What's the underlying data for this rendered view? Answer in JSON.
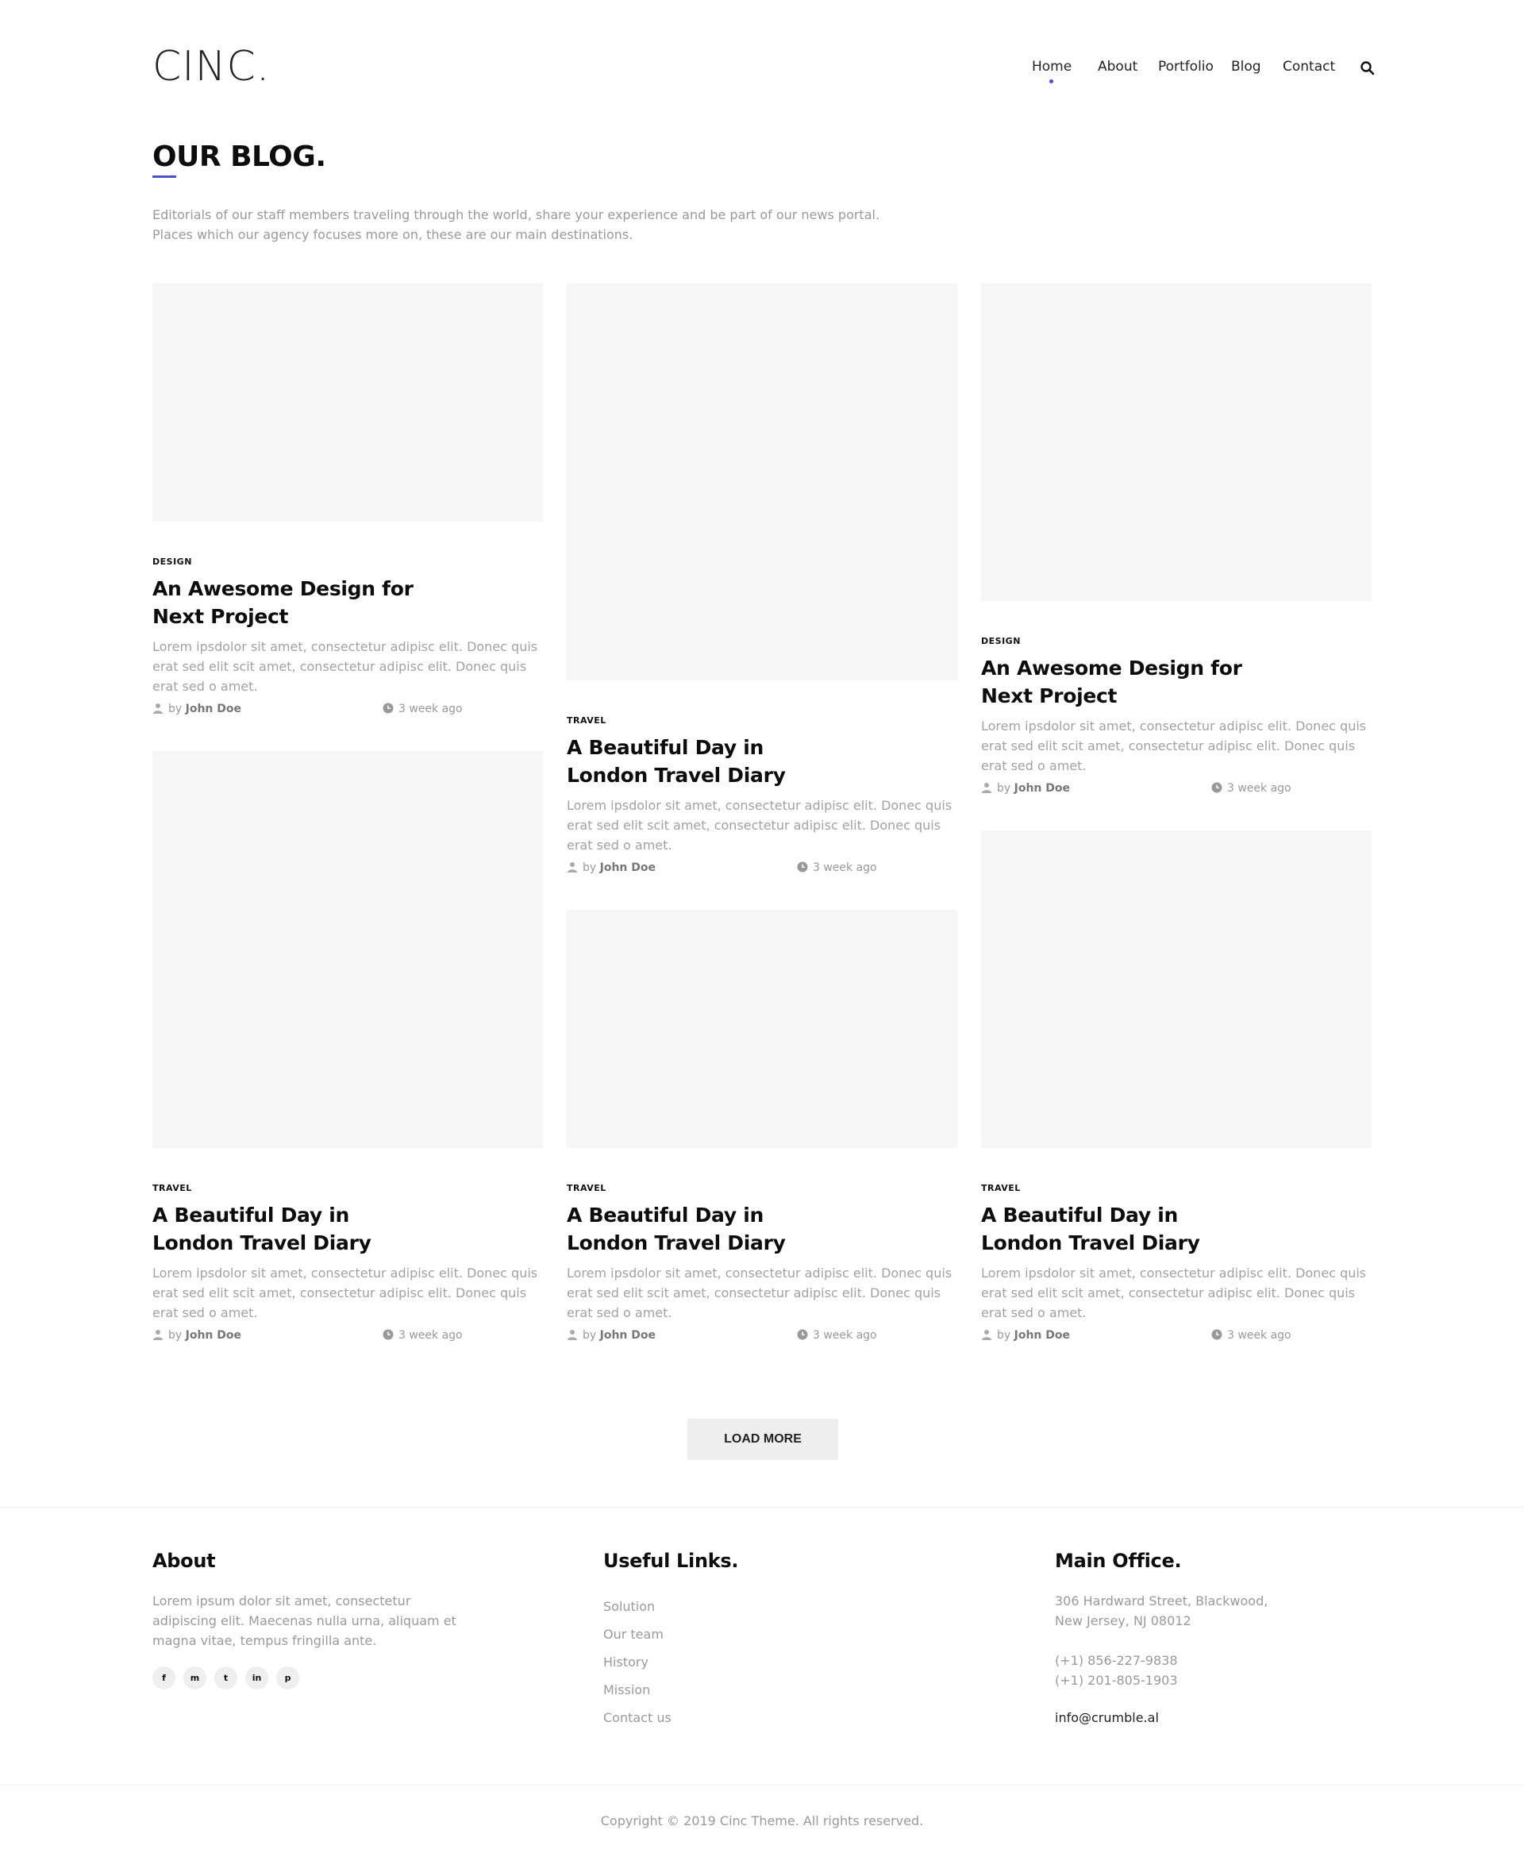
{
  "brand": {
    "logo": "CINC."
  },
  "nav": {
    "items": [
      {
        "label": "Home",
        "active": true
      },
      {
        "label": "About",
        "active": false
      },
      {
        "label": "Portfolio",
        "active": false
      },
      {
        "label": "Blog",
        "active": false
      },
      {
        "label": "Contact",
        "active": false
      }
    ],
    "search_icon": "search-icon",
    "accent_color": "#4a4ce6"
  },
  "hero": {
    "title": "OUR BLOG.",
    "intro_line1": "Editorials of our staff members traveling through the world, share your experience and be part of our news portal.",
    "intro_line2": "Places which our agency focuses more on, these are our main destinations."
  },
  "posts": [
    {
      "category": "DESIGN",
      "title": "An Awesome Design for Next Project",
      "excerpt": "Lorem ipsdolor sit amet, consectetur adipisc elit. Donec quis erat sed elit scit amet, consectetur adipisc elit. Donec quis erat sed o amet.",
      "author_prefix": "by",
      "author": "John Doe",
      "time": "3 week ago"
    },
    {
      "category": "TRAVEL",
      "title": "A Beautiful Day in London Travel Diary",
      "excerpt": "Lorem ipsdolor sit amet, consectetur adipisc elit. Donec quis erat sed elit scit amet, consectetur adipisc elit. Donec quis erat sed o amet.",
      "author_prefix": "by",
      "author": "John Doe",
      "time": "3 week ago"
    },
    {
      "category": "DESIGN",
      "title": "An Awesome Design for Next Project",
      "excerpt": "Lorem ipsdolor sit amet, consectetur adipisc elit. Donec quis erat sed elit scit amet, consectetur adipisc elit. Donec quis erat sed o amet.",
      "author_prefix": "by",
      "author": "John Doe",
      "time": "3 week ago"
    },
    {
      "category": "TRAVEL",
      "title": "A Beautiful Day in London Travel Diary",
      "excerpt": "Lorem ipsdolor sit amet, consectetur adipisc elit. Donec quis erat sed elit scit amet, consectetur adipisc elit. Donec quis erat sed o amet.",
      "author_prefix": "by",
      "author": "John Doe",
      "time": "3 week ago"
    },
    {
      "category": "TRAVEL",
      "title": "A Beautiful Day in London Travel Diary",
      "excerpt": "Lorem ipsdolor sit amet, consectetur adipisc elit. Donec quis erat sed elit scit amet, consectetur adipisc elit. Donec quis erat sed o amet.",
      "author_prefix": "by",
      "author": "John Doe",
      "time": "3 week ago"
    },
    {
      "category": "TRAVEL",
      "title": "A Beautiful Day in London Travel Diary",
      "excerpt": "Lorem ipsdolor sit amet, consectetur adipisc elit. Donec quis erat sed elit scit amet, consectetur adipisc elit. Donec quis erat sed o amet.",
      "author_prefix": "by",
      "author": "John Doe",
      "time": "3 week ago"
    }
  ],
  "load_more": {
    "label": "LOAD MORE"
  },
  "footer": {
    "about": {
      "heading": "About",
      "text": "Lorem ipsum dolor sit amet, consectetur adipiscing elit. Maecenas nulla urna, aliquam et magna vitae, tempus fringilla ante.",
      "social": [
        {
          "icon": "facebook-icon",
          "glyph": "f"
        },
        {
          "icon": "messenger-icon",
          "glyph": "m"
        },
        {
          "icon": "twitter-icon",
          "glyph": "t"
        },
        {
          "icon": "linkedin-icon",
          "glyph": "in"
        },
        {
          "icon": "pinterest-icon",
          "glyph": "p"
        }
      ]
    },
    "links": {
      "heading": "Useful Links.",
      "items": [
        "Solution",
        "Our team",
        "History",
        "Mission",
        "Contact us"
      ]
    },
    "office": {
      "heading": "Main Office.",
      "address_line1": "306 Hardward Street, Blackwood,",
      "address_line2": "New Jersey, NJ 08012",
      "phone1": "(+1) 856-227-9838",
      "phone2": "(+1) 201-805-1903",
      "email": "info@crumble.al"
    },
    "copyright": "Copyright © 2019 Cinc Theme. All rights reserved."
  }
}
